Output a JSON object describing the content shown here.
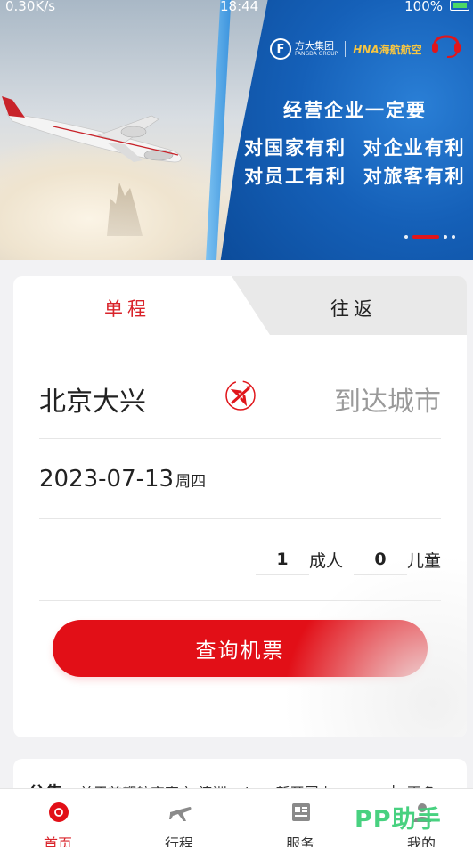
{
  "status_bar": {
    "network": "0.30K/s",
    "time": "18:44",
    "battery": "100%"
  },
  "banner": {
    "brand_fangda": "方大集团",
    "brand_fangda_en": "FANGDA GROUP",
    "brand_hna": "HNA",
    "brand_hna_cn": "海航航空",
    "slogan_line1": "经营企业一定要",
    "slogan_line2": "对国家有利  对企业有利",
    "slogan_line3": "对员工有利  对旅客有利"
  },
  "booking": {
    "tabs": [
      {
        "label": "单程",
        "active": true
      },
      {
        "label": "往返",
        "active": false
      }
    ],
    "from_city": "北京大兴",
    "to_placeholder": "到达城市",
    "date": "2023-07-13",
    "weekday": "周四",
    "adults_count": "1",
    "adults_label": "成人",
    "children_count": "0",
    "children_label": "儿童",
    "search_label": "查询机票"
  },
  "notice": {
    "tag": "公告",
    "text": "关于首都航空声言-澳洲unique新开国内",
    "separator": "|",
    "more": "更多"
  },
  "nav": {
    "items": [
      {
        "label": "首页",
        "icon": "home-icon",
        "active": true
      },
      {
        "label": "行程",
        "icon": "plane-icon",
        "active": false
      },
      {
        "label": "服务",
        "icon": "service-icon",
        "active": false
      },
      {
        "label": "我的",
        "icon": "user-icon",
        "active": false
      }
    ]
  },
  "watermark": "PP助手",
  "colors": {
    "accent": "#e20f17",
    "tab_active": "#d9232a",
    "banner_blue": "#1560b8",
    "hna_gold": "#f5c542"
  }
}
